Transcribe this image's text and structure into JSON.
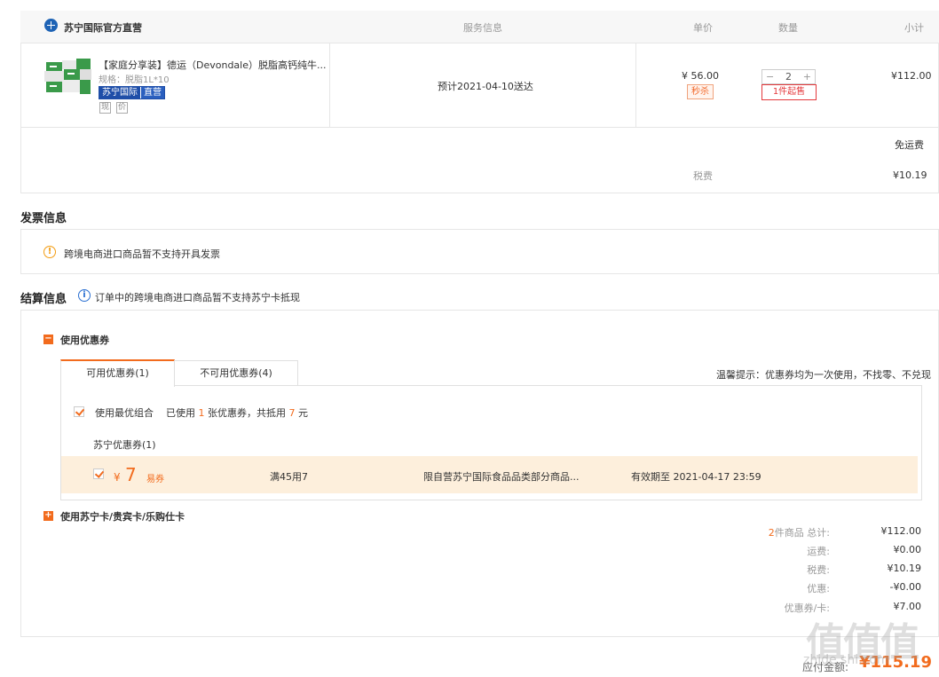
{
  "store": {
    "name": "苏宁国际官方直营",
    "col_service": "服务信息",
    "col_price": "单价",
    "col_qty": "数量",
    "col_subtotal": "小计"
  },
  "product": {
    "title": "【家庭分享装】德运（Devondale）脱脂高钙纯牛...",
    "spec": "规格：脱脂1L*10",
    "tag_a": "苏宁国际",
    "tag_b": "直营",
    "icon_1": "现",
    "icon_2": "价",
    "delivery": "预计2021-04-10送达",
    "price": "¥ 56.00",
    "flash_sale": "秒杀",
    "qty": "2",
    "qty_minus": "−",
    "qty_plus": "+",
    "min_order": "1件起售",
    "subtotal": "¥112.00",
    "free_shipping": "免运费",
    "tax_label": "税费",
    "tax_value": "¥10.19"
  },
  "invoice": {
    "title": "发票信息",
    "notice": "跨境电商进口商品暂不支持开具发票"
  },
  "settlement": {
    "title": "结算信息",
    "notice": "订单中的跨境电商进口商品暂不支持苏宁卡抵现",
    "use_coupon": "使用优惠券",
    "tab_available": "可用优惠券(1)",
    "tab_unavailable": "不可用优惠券(4)",
    "tip": "温馨提示：优惠券均为一次使用，不找零、不兑现",
    "best_combo": "使用最优组合",
    "used_prefix": "已使用",
    "used_count": "1",
    "used_mid": "张优惠券，共抵用",
    "used_amount": "7",
    "used_suffix": "元",
    "group_title": "苏宁优惠券(1)",
    "coupon_symbol": "¥",
    "coupon_amount": "7",
    "coupon_type": "易券",
    "coupon_condition": "满45用7",
    "coupon_scope": "限自营苏宁国际食品品类部分商品...",
    "coupon_expiry": "有效期至 2021-04-17 23:59",
    "use_card": "使用苏宁卡/贵宾卡/乐购仕卡"
  },
  "summary": {
    "count": "2",
    "count_label": "件商品 总计:",
    "total": "¥112.00",
    "shipping_label": "运费:",
    "shipping": "¥0.00",
    "tax_label": "税费:",
    "tax": "¥10.19",
    "discount_label": "优惠:",
    "discount": "-¥0.00",
    "coupon_label": "优惠券/卡:",
    "coupon": "¥7.00",
    "payable_label": "应付金额:",
    "payable": "¥115.19"
  },
  "watermark": {
    "main": "值值值",
    "sub": "zhide.shi.com"
  },
  "colors": {
    "accent": "#f26b1d",
    "brand_blue": "#1e4ea8",
    "red": "#e4393c"
  }
}
